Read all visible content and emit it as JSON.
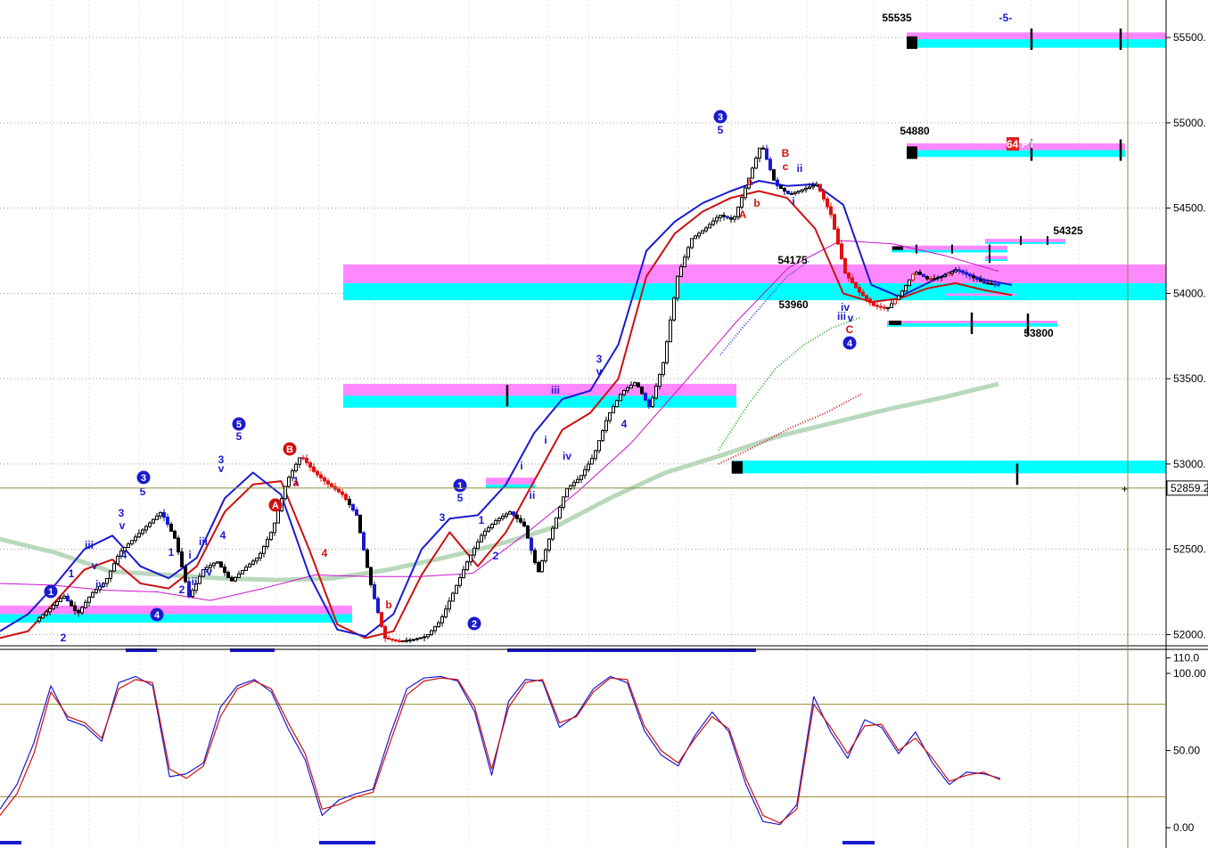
{
  "chart_data": [
    {
      "type": "candlestick",
      "title": "",
      "xlabel": "",
      "ylabel": "",
      "ylim": [
        51950,
        55720
      ],
      "y_ticks": [
        "55500.",
        "55000.",
        "54500.",
        "54000.",
        "53500.",
        "53000.",
        "52500.",
        "52000."
      ],
      "current_price_label": "52859.2",
      "grid": "dotted horizontal",
      "price_path": [
        52080,
        52150,
        52230,
        52120,
        52240,
        52310,
        52480,
        52560,
        52640,
        52720,
        52560,
        52220,
        52380,
        52430,
        52310,
        52390,
        52460,
        52620,
        52900,
        53050,
        52950,
        52880,
        52820,
        52700,
        52300,
        51980,
        51960,
        51970,
        51990,
        52080,
        52260,
        52440,
        52590,
        52670,
        52720,
        52640,
        52360,
        52610,
        52850,
        52920,
        53050,
        53280,
        53420,
        53480,
        53330,
        53600,
        54100,
        54320,
        54380,
        54460,
        54430,
        54650,
        54880,
        54640,
        54580,
        54610,
        54640,
        54460,
        54120,
        54010,
        53930,
        53910,
        54000,
        54130,
        54080,
        54100,
        54140,
        54100,
        54060,
        54050
      ],
      "series": [
        {
          "name": "",
          "color": "#1a1ad0",
          "values": [
            52020,
            52120,
            52300,
            52500,
            52580,
            52400,
            52330,
            52450,
            52800,
            52950,
            52820,
            52350,
            52030,
            51990,
            52120,
            52500,
            52680,
            52700,
            52880,
            53180,
            53380,
            53430,
            53700,
            54250,
            54420,
            54530,
            54600,
            54660,
            54630,
            54640,
            54520,
            54050,
            53980,
            54060,
            54140,
            54080,
            54050
          ]
        },
        {
          "name": "",
          "color": "#cc1010",
          "values": [
            51980,
            52020,
            52200,
            52380,
            52440,
            52300,
            52270,
            52400,
            52720,
            52880,
            52900,
            52500,
            52060,
            51980,
            52020,
            52350,
            52600,
            52400,
            52600,
            52900,
            53200,
            53300,
            53500,
            54100,
            54350,
            54480,
            54560,
            54600,
            54560,
            54380,
            54000,
            53950,
            53970,
            54030,
            54060,
            54020,
            53990
          ]
        },
        {
          "name": "",
          "color": "#b9d8bd",
          "values": [
            52560,
            52480,
            52370,
            52350,
            52330,
            52320,
            52330,
            52380,
            52450,
            52530,
            52630,
            52800,
            52950,
            53050,
            53160,
            53240,
            53320,
            53390,
            53470
          ]
        },
        {
          "name": "",
          "color": "#cc10cc",
          "values": [
            52300,
            52290,
            52260,
            52250,
            52200,
            52270,
            52350,
            52340,
            52340,
            52360,
            52590,
            52840,
            53120,
            53470,
            53830,
            54150,
            54310,
            54290,
            54220,
            54130
          ]
        },
        {
          "name": "",
          "color": "#4a4ad8",
          "values": [
            53640,
            53800,
            53950,
            54100,
            54190
          ]
        },
        {
          "name": "",
          "color": "#30b030",
          "values": [
            53080,
            53340,
            53560,
            53700,
            53800,
            53860
          ]
        },
        {
          "name": "",
          "color": "#c02020",
          "values": [
            53000,
            53100,
            53210,
            53300,
            53410
          ]
        }
      ],
      "level_labels": [
        "55535",
        "54880",
        "54325",
        "54175",
        "53960",
        "53800"
      ],
      "wave_labels": [
        "1",
        "2",
        "3",
        "4",
        "5",
        "A",
        "B",
        "C",
        "a",
        "b",
        "c",
        "i",
        "ii",
        "iii",
        "iv",
        "v",
        "-5-",
        "64 PT"
      ]
    },
    {
      "type": "line",
      "title": "",
      "ylim": [
        -12,
        115
      ],
      "y_ticks": [
        "110.0",
        "100.00",
        "50.00",
        "0.00"
      ],
      "reference_lines": [
        80,
        20
      ],
      "series": [
        {
          "name": "",
          "color": "#1a1ad0",
          "values": [
            12,
            28,
            55,
            92,
            70,
            66,
            56,
            94,
            98,
            92,
            33,
            35,
            42,
            78,
            92,
            96,
            88,
            64,
            44,
            8,
            18,
            22,
            25,
            60,
            90,
            97,
            98,
            95,
            75,
            34,
            82,
            96,
            95,
            65,
            73,
            90,
            98,
            94,
            63,
            47,
            40,
            60,
            75,
            62,
            28,
            4,
            2,
            15,
            85,
            62,
            45,
            70,
            65,
            48,
            62,
            42,
            28,
            36,
            35,
            32
          ]
        },
        {
          "name": "",
          "color": "#cc1010",
          "values": [
            8,
            22,
            48,
            88,
            72,
            68,
            58,
            90,
            96,
            94,
            38,
            32,
            40,
            72,
            90,
            95,
            90,
            68,
            48,
            12,
            15,
            20,
            23,
            55,
            86,
            95,
            97,
            96,
            78,
            38,
            78,
            94,
            96,
            68,
            72,
            88,
            97,
            96,
            66,
            50,
            42,
            58,
            72,
            64,
            32,
            8,
            3,
            12,
            80,
            65,
            48,
            66,
            67,
            50,
            58,
            45,
            30,
            34,
            36,
            31
          ]
        }
      ]
    }
  ]
}
